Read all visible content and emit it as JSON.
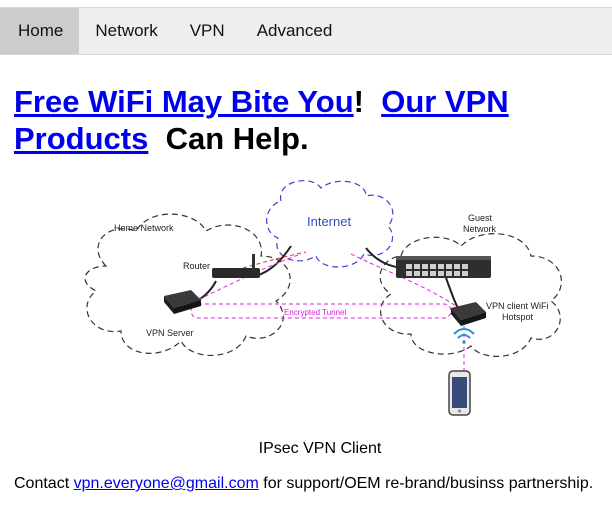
{
  "nav": {
    "items": [
      {
        "label": "Home",
        "active": true
      },
      {
        "label": "Network",
        "active": false
      },
      {
        "label": "VPN",
        "active": false
      },
      {
        "label": "Advanced",
        "active": false
      }
    ]
  },
  "headline": {
    "link1": "Free WiFi May Bite You",
    "sep1": "!",
    "link2": "Our VPN Products",
    "tail": "Can Help."
  },
  "diagram": {
    "internet": "Internet",
    "home_network": "Home Network",
    "router": "Router",
    "vpn_server": "VPN Server",
    "guest_network_1": "Guest",
    "guest_network_2": "Network",
    "encrypted_tunnel": "Encrypted Tunnel",
    "vpn_client_1": "VPN  client WiFi",
    "vpn_client_2": "Hotspot"
  },
  "caption": "IPsec VPN Client",
  "contact": {
    "prefix": "Contact ",
    "email": "vpn.everyone@gmail.com",
    "suffix": " for support/OEM re-brand/businss partnership."
  },
  "colors": {
    "link": "#0000ee",
    "nav_bg": "#eeeeee",
    "nav_active": "#cccccc",
    "tunnel": "#e020e0",
    "internet_cloud": "#4040d0",
    "internet_text": "#3050c0"
  }
}
